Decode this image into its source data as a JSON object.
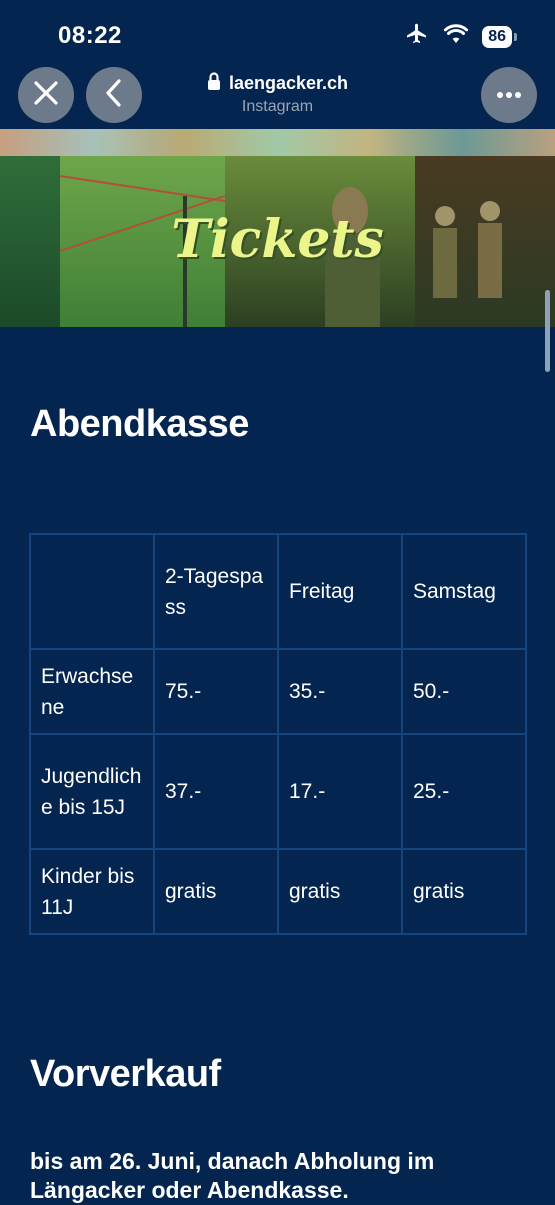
{
  "status_bar": {
    "time": "08:22",
    "battery": "86"
  },
  "browser": {
    "url": "laengacker.ch",
    "source": "Instagram"
  },
  "hero": {
    "title": "Tickets"
  },
  "abendkasse": {
    "heading": "Abendkasse",
    "columns": [
      "",
      "2-Tagespass",
      "Freitag",
      "Samstag"
    ],
    "rows": [
      {
        "label": "Erwachsene",
        "values": [
          "75.-",
          "35.-",
          "50.-"
        ]
      },
      {
        "label": "Jugendliche bis 15J",
        "values": [
          "37.-",
          "17.-",
          "25.-"
        ]
      },
      {
        "label": "Kinder bis 11J",
        "values": [
          "gratis",
          "gratis",
          "gratis"
        ]
      }
    ]
  },
  "vorverkauf": {
    "heading": "Vorverkauf",
    "text": "bis am 26. Juni, danach Abholung im Längacker oder Abendkasse."
  }
}
